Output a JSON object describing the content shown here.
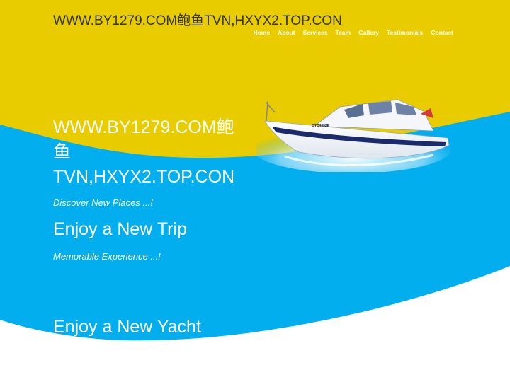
{
  "site": {
    "title": "WWW.BY1279.COM鲍鱼TVN,HXYX2.TOP.CON"
  },
  "nav": [
    "Home",
    "About",
    "Services",
    "Team",
    "Gallery",
    "Testimonials",
    "Contact"
  ],
  "hero": {
    "title": "WWW.BY1279.COM鲍鱼TVN,HXYX2.TOP.CON",
    "tagline1": "Discover New Places ...!",
    "heading2": "Enjoy a New Trip",
    "tagline2": "Memorable Experience ...!",
    "heading3": "Enjoy a New Yacht"
  },
  "boat": {
    "hull_text": "OTC4332E"
  },
  "colors": {
    "yellow": "#e8cc00",
    "blue": "#02aeee",
    "white": "#ffffff",
    "text_dark": "#333333"
  }
}
